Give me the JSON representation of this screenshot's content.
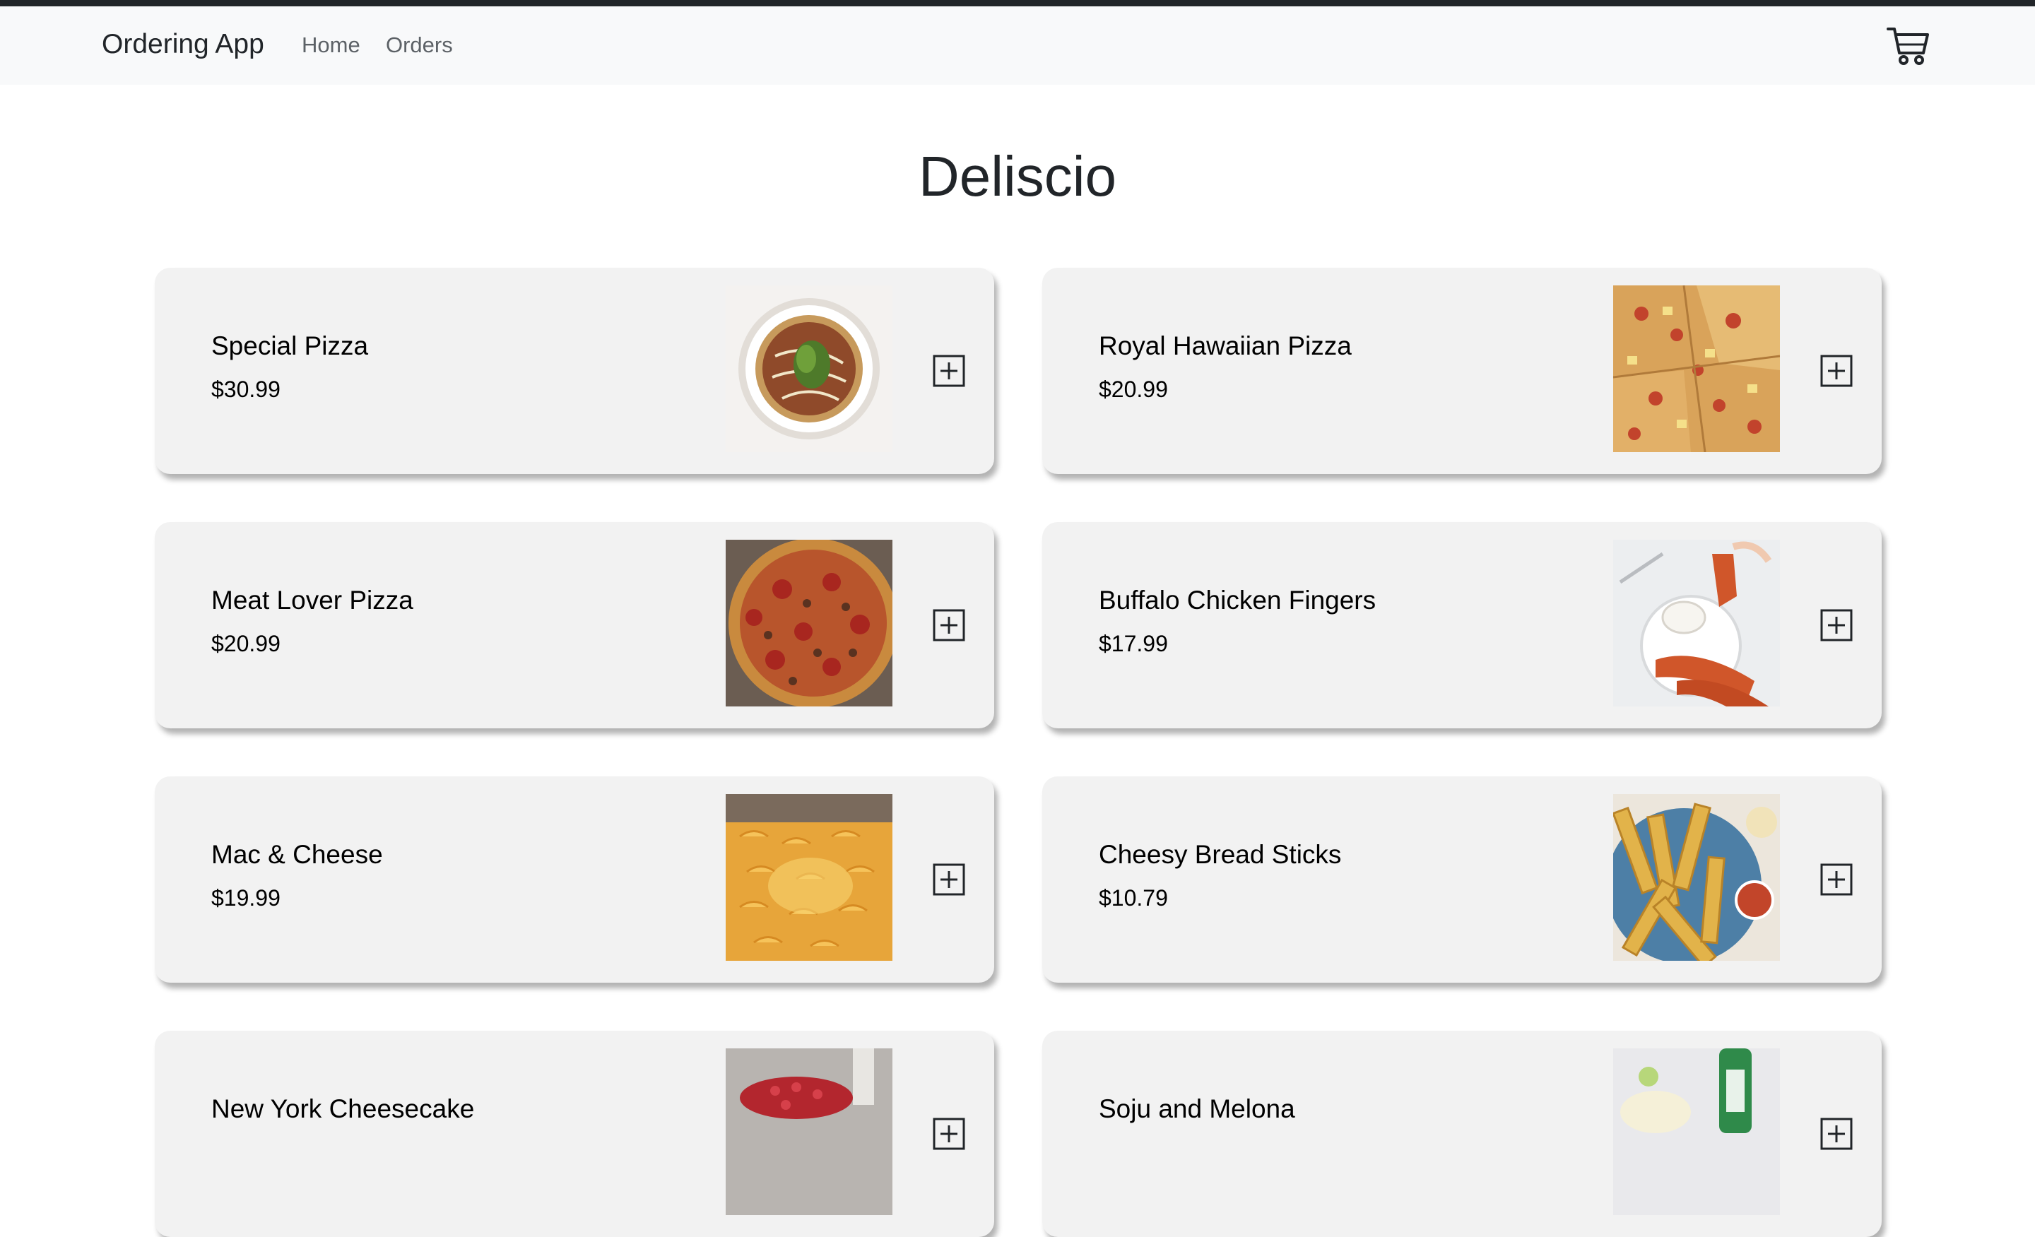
{
  "navbar": {
    "brand": "Ordering App",
    "links": [
      "Home",
      "Orders"
    ],
    "cart_icon": "cart-icon"
  },
  "page": {
    "title": "Deliscio"
  },
  "menu_items": [
    {
      "name": "Special Pizza",
      "price": "$30.99",
      "image": "special-pizza-photo"
    },
    {
      "name": "Royal Hawaiian Pizza",
      "price": "$20.99",
      "image": "royal-hawaiian-pizza-photo"
    },
    {
      "name": "Meat Lover Pizza",
      "price": "$20.99",
      "image": "meat-lover-pizza-photo"
    },
    {
      "name": "Buffalo Chicken Fingers",
      "price": "$17.99",
      "image": "buffalo-chicken-fingers-photo"
    },
    {
      "name": "Mac & Cheese",
      "price": "$19.99",
      "image": "mac-and-cheese-photo"
    },
    {
      "name": "Cheesy Bread Sticks",
      "price": "$10.79",
      "image": "cheesy-bread-sticks-photo"
    },
    {
      "name": "New York Cheesecake",
      "price": "",
      "image": "new-york-cheesecake-photo"
    },
    {
      "name": "Soju and Melona",
      "price": "",
      "image": "soju-and-melona-photo"
    }
  ],
  "add_icon": "plus-square-icon",
  "colors": {
    "top_strip": "#212529",
    "navbar_bg": "#f8f9fa",
    "card_bg": "#f2f2f2"
  }
}
